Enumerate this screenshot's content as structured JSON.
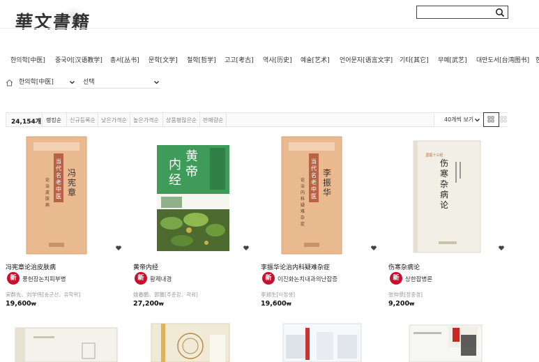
{
  "logo": {
    "text": "華文書籍"
  },
  "search": {
    "placeholder": ""
  },
  "categories": [
    "한의학[中医]",
    "중국어[汉语教学]",
    "총서[丛书]",
    "문학[文学]",
    "철학[哲学]",
    "고고[考古]",
    "역사[历史]",
    "예술[艺术]",
    "언어문자[语言文字]",
    "기타[其它]",
    "무예[武艺]",
    "대만도서[台湾图书]",
    "한"
  ],
  "breadcrumb": {
    "level1": "한의학[中医]",
    "level2": "선택"
  },
  "sortbar": {
    "count": "24,154개",
    "options": [
      "랭킹순",
      "신규등록순",
      "낮은가격순",
      "높은가격순",
      "상품평많은순",
      "판매량순"
    ],
    "view_per_page": "40개씩 보기"
  },
  "products": [
    {
      "title": "冯宪章论治皮肤病",
      "badge": "新",
      "subtitle": "풍헌장논치피부병",
      "author": "宋群先、刘学伟[송군선、유학위]",
      "price": "19,600",
      "currency": "₩"
    },
    {
      "title": "黄帝内经",
      "badge": "新",
      "subtitle": "황제내경",
      "author": "姚春鹏、郭蕾[주춘강、곽뢰]",
      "price": "27,200",
      "currency": "₩"
    },
    {
      "title": "李振华论治内科疑难杂症",
      "badge": "新",
      "subtitle": "이진화논치내과의난잡증",
      "author": "李郑生[이정생]",
      "price": "19,600",
      "currency": "₩"
    },
    {
      "title": "伤寒杂病论",
      "badge": "新",
      "subtitle": "상한잡병론",
      "author": "张仲景[장중경]",
      "price": "9,200",
      "currency": "₩"
    }
  ],
  "product_images": [
    {
      "cover_text": [
        "当代名老中医",
        "冯宪章",
        "论治皮肤病"
      ]
    },
    {
      "cover_text": [
        "黄帝",
        "内经"
      ]
    },
    {
      "cover_text": [
        "当代名老中医",
        "李振华",
        "论治内科疑难杂症"
      ]
    },
    {
      "cover_text": [
        "国医十三经",
        "伤寒杂病论"
      ]
    }
  ],
  "colors": {
    "badge": "#c8102e",
    "cover_tan": "#e9b98f",
    "cover_green": "#3e9b5a"
  }
}
